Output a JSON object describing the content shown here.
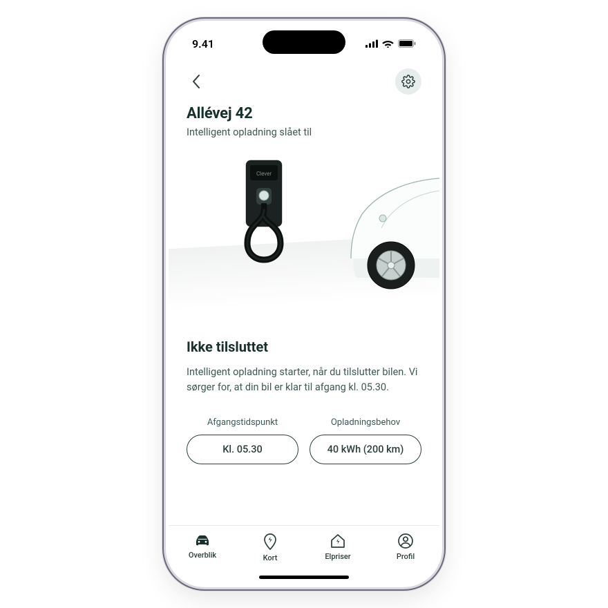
{
  "status_bar": {
    "time": "9.41"
  },
  "colors": {
    "text_primary": "#16302b",
    "text_secondary": "#3e5954",
    "accent_bg": "#e6edec"
  },
  "page": {
    "title": "Allévej 42",
    "subtitle": "Intelligent opladning slået til",
    "charger_brand": "Clever",
    "status_heading": "Ikke tilsluttet",
    "status_description": "Intelligent opladning starter, når du tilslutter bilen. Vi sørger for, at din bil er klar til afgang kl. 05.30."
  },
  "settings": [
    {
      "label": "Afgangstidspunkt",
      "value": "Kl. 05.30"
    },
    {
      "label": "Opladningsbehov",
      "value": "40 kWh (200 km)"
    }
  ],
  "tabs": [
    {
      "label": "Overblik",
      "icon": "car-icon",
      "active": true
    },
    {
      "label": "Kort",
      "icon": "pin-bolt-icon",
      "active": false
    },
    {
      "label": "Elpriser",
      "icon": "house-bolt-icon",
      "active": false
    },
    {
      "label": "Profil",
      "icon": "person-circle-icon",
      "active": false
    }
  ]
}
